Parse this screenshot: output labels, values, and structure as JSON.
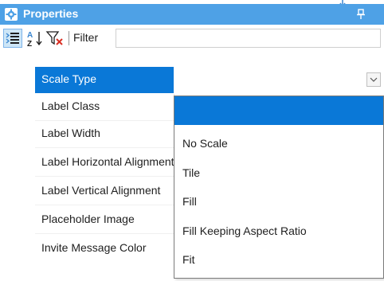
{
  "window": {
    "title": "Properties",
    "icon": "gear-icon",
    "pin_icon": "pin-icon",
    "accent_color": "#4ea1e6"
  },
  "toolbar": {
    "filter_label": "Filter",
    "filter_value": "",
    "buttons": [
      "categorized-icon",
      "sort-alphabetical-icon",
      "filter-icon"
    ]
  },
  "properties": [
    {
      "name": "Scale Type",
      "value": ""
    },
    {
      "name": "Label Class",
      "value": ""
    },
    {
      "name": "Label Width",
      "value": ""
    },
    {
      "name": "Label Horizontal Alignment",
      "value": ""
    },
    {
      "name": "Label Vertical Alignment",
      "value": ""
    },
    {
      "name": "Placeholder Image",
      "value": ""
    },
    {
      "name": "Invite Message Color",
      "value": ""
    }
  ],
  "selected_property": "Scale Type",
  "dropdown": {
    "options": [
      "",
      "No Scale",
      "Tile",
      "Fill",
      "Fill Keeping Aspect Ratio",
      "Fit"
    ],
    "highlighted": ""
  },
  "colors": {
    "selection": "#0a78d7",
    "title_bar": "#4ea1e6"
  }
}
